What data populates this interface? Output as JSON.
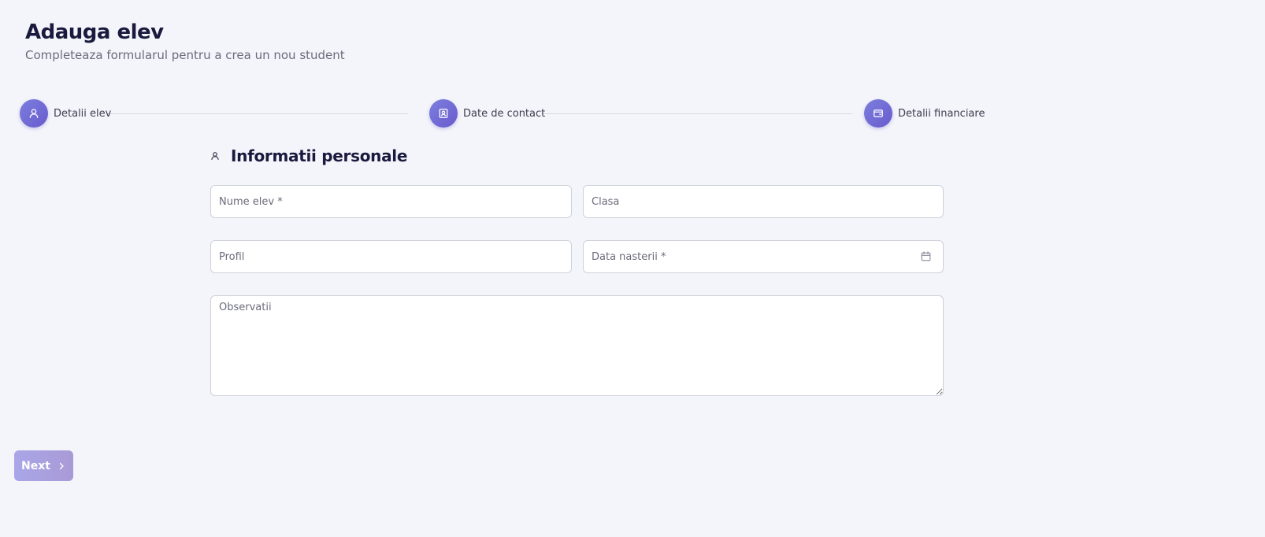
{
  "header": {
    "title": "Adauga elev",
    "subtitle": "Completeaza formularul pentru a crea un nou student"
  },
  "stepper": {
    "steps": [
      {
        "label": "Detalii elev",
        "icon": "user-icon"
      },
      {
        "label": "Date de contact",
        "icon": "contact-book-icon"
      },
      {
        "label": "Detalii financiare",
        "icon": "wallet-icon"
      }
    ]
  },
  "section": {
    "title": "Informatii personale",
    "icon": "user-outline-icon"
  },
  "form": {
    "nume_elev": {
      "placeholder": "Nume elev *",
      "value": ""
    },
    "clasa": {
      "placeholder": "Clasa",
      "value": ""
    },
    "profil": {
      "placeholder": "Profil",
      "value": ""
    },
    "data_nasterii": {
      "placeholder": "Data nasterii *",
      "value": ""
    },
    "observatii": {
      "placeholder": "Observatii",
      "value": ""
    }
  },
  "actions": {
    "next_label": "Next"
  },
  "colors": {
    "accent": "#6a5acd",
    "background": "#f4f5fa",
    "title": "#1a1a3e"
  }
}
